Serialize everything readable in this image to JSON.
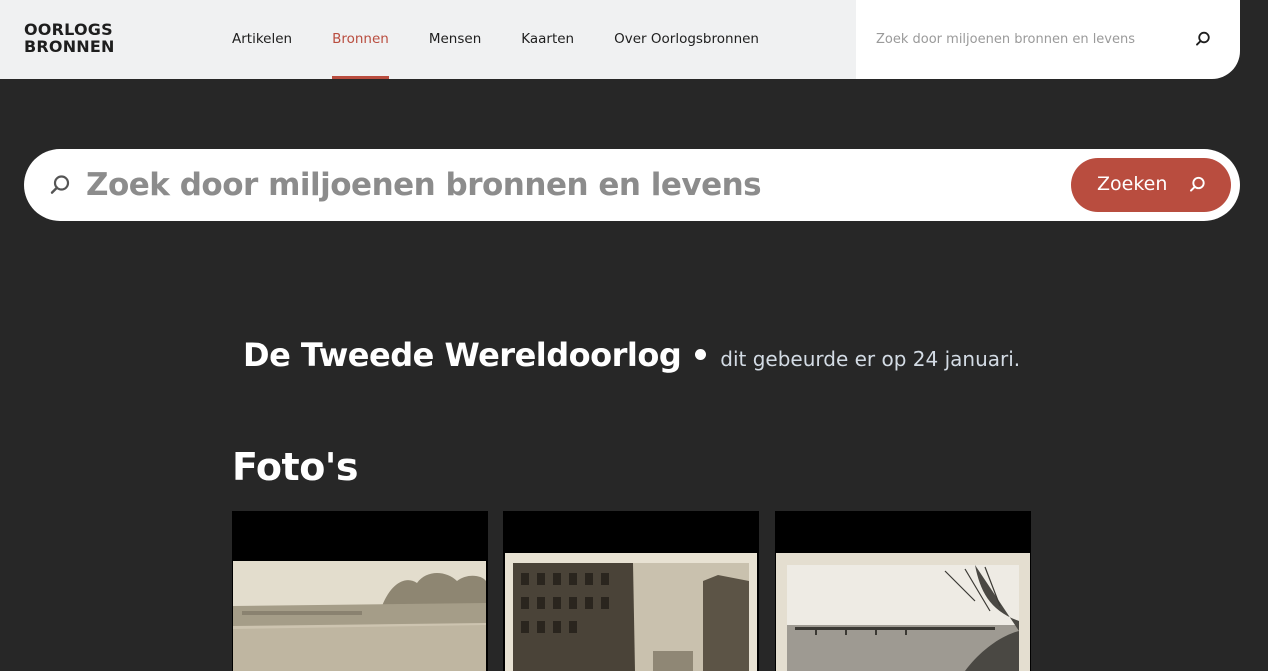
{
  "header": {
    "logo_line1": "OORLOGS",
    "logo_line2": "BRONNEN",
    "nav": [
      {
        "label": "Artikelen",
        "active": false
      },
      {
        "label": "Bronnen",
        "active": true
      },
      {
        "label": "Mensen",
        "active": false
      },
      {
        "label": "Kaarten",
        "active": false
      },
      {
        "label": "Over Oorlogsbronnen",
        "active": false
      }
    ],
    "search_placeholder": "Zoek door miljoenen bronnen en levens",
    "search_icon": "search-icon"
  },
  "hero_search": {
    "placeholder": "Zoek door miljoenen bronnen en levens",
    "button_label": "Zoeken",
    "icon": "search-icon"
  },
  "day": {
    "title": "De Tweede Wereldoorlog",
    "subtitle": "dit gebeurde er op 24 januari."
  },
  "photos": {
    "section_title": "Foto's",
    "items": [
      {
        "name": "landscape-photo"
      },
      {
        "name": "street-ruins-photo"
      },
      {
        "name": "river-bridge-photo"
      }
    ]
  },
  "colors": {
    "accent": "#b94d3f",
    "background": "#272727",
    "header_bg": "#f0f1f2"
  }
}
